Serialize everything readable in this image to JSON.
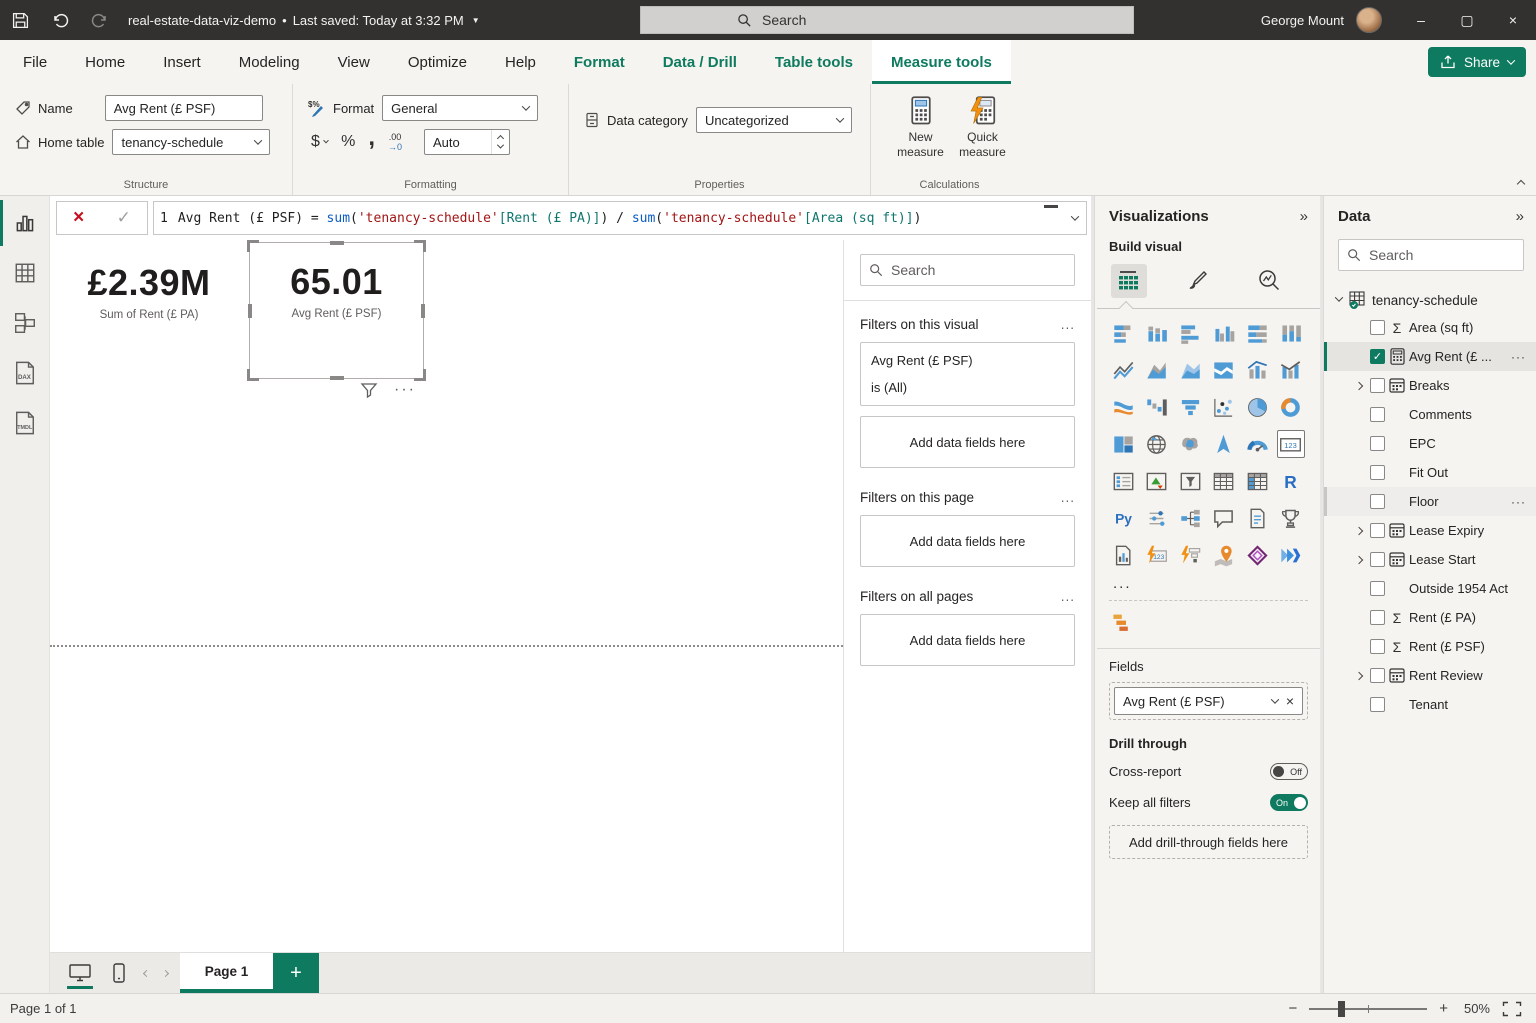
{
  "titlebar": {
    "title": "real-estate-data-viz-demo",
    "separator": "•",
    "saved": "Last saved: Today at 3:32 PM",
    "search_placeholder": "Search",
    "user": "George Mount",
    "minimize": "–",
    "maximize": "▢",
    "close": "×"
  },
  "menubar": {
    "tabs": [
      {
        "label": "File"
      },
      {
        "label": "Home"
      },
      {
        "label": "Insert"
      },
      {
        "label": "Modeling"
      },
      {
        "label": "View"
      },
      {
        "label": "Optimize"
      },
      {
        "label": "Help"
      },
      {
        "label": "Format",
        "ctx": true
      },
      {
        "label": "Data / Drill",
        "ctx": true
      },
      {
        "label": "Table tools",
        "ctx": true
      },
      {
        "label": "Measure tools",
        "ctx": true,
        "active": true
      }
    ],
    "share_label": "Share"
  },
  "ribbon": {
    "structure": {
      "label": "Structure",
      "name_label": "Name",
      "name_value": "Avg Rent (£ PSF)",
      "home_table_label": "Home table",
      "home_table_value": "tenancy-schedule"
    },
    "formatting": {
      "label": "Formatting",
      "format_label": "Format",
      "format_value": "General",
      "dollar": "$",
      "percent": "%",
      "comma": ",",
      "decimal_top": ".00",
      "decimal_bottom": "→0",
      "auto": "Auto"
    },
    "properties": {
      "label": "Properties",
      "data_category_label": "Data category",
      "data_category_value": "Uncategorized"
    },
    "calculations": {
      "label": "Calculations",
      "new_measure": "New measure",
      "quick_measure": "Quick measure"
    }
  },
  "formula": {
    "line_number": "1",
    "tokens": [
      {
        "t": "Avg Rent (£ PSF) = ",
        "c": "p"
      },
      {
        "t": "sum",
        "c": "f"
      },
      {
        "t": "(",
        "c": "p"
      },
      {
        "t": "'tenancy-schedule'",
        "c": "s"
      },
      {
        "t": "[Rent (£ PA)]",
        "c": "c"
      },
      {
        "t": ") / ",
        "c": "p"
      },
      {
        "t": "sum",
        "c": "f"
      },
      {
        "t": "(",
        "c": "p"
      },
      {
        "t": "'tenancy-schedule'",
        "c": "s"
      },
      {
        "t": "[Area (sq ft)]",
        "c": "c"
      },
      {
        "t": ")",
        "c": "p"
      }
    ]
  },
  "canvas": {
    "cards": [
      {
        "value": "£2.39M",
        "label": "Sum of Rent (£ PA)",
        "selected": false
      },
      {
        "value": "65.01",
        "label": "Avg Rent (£ PSF)",
        "selected": true
      }
    ]
  },
  "filters": {
    "search_placeholder": "Search",
    "sections": [
      {
        "title": "Filters on this visual",
        "more": "...",
        "cards": [
          {
            "field": "Avg Rent (£ PSF)",
            "condition": "is (All)"
          }
        ],
        "placeholder": "Add data fields here"
      },
      {
        "title": "Filters on this page",
        "more": "...",
        "cards": [],
        "placeholder": "Add data fields here"
      },
      {
        "title": "Filters on all pages",
        "more": "...",
        "cards": [],
        "placeholder": "Add data fields here"
      }
    ]
  },
  "visualizations": {
    "title": "Visualizations",
    "collapse": "»",
    "build_visual_label": "Build visual",
    "gallery": [
      {
        "n": "stacked-bar-chart",
        "k": "sbar"
      },
      {
        "n": "stacked-column-chart",
        "k": "scol"
      },
      {
        "n": "clustered-bar-chart",
        "k": "cbar"
      },
      {
        "n": "clustered-column-chart",
        "k": "ccol"
      },
      {
        "n": "100-stacked-bar-chart",
        "k": "pbar"
      },
      {
        "n": "100-stacked-column-chart",
        "k": "pcol"
      },
      {
        "n": "line-chart",
        "k": "line"
      },
      {
        "n": "area-chart",
        "k": "area"
      },
      {
        "n": "stacked-area-chart",
        "k": "sarea"
      },
      {
        "n": "100-stacked-area-chart",
        "k": "parea"
      },
      {
        "n": "line-and-stacked-column-chart",
        "k": "combo"
      },
      {
        "n": "line-and-clustered-column-chart",
        "k": "combo2"
      },
      {
        "n": "ribbon-chart",
        "k": "ribbon"
      },
      {
        "n": "waterfall-chart",
        "k": "waterfall"
      },
      {
        "n": "funnel-chart",
        "k": "funnel"
      },
      {
        "n": "scatter-chart",
        "k": "scatter"
      },
      {
        "n": "pie-chart",
        "k": "pie"
      },
      {
        "n": "donut-chart",
        "k": "donut"
      },
      {
        "n": "treemap",
        "k": "treemap"
      },
      {
        "n": "map",
        "k": "globe"
      },
      {
        "n": "filled-map",
        "k": "shapemap"
      },
      {
        "n": "azure-map",
        "k": "plane"
      },
      {
        "n": "gauge",
        "k": "gauge"
      },
      {
        "n": "card",
        "k": "card123",
        "selected": true
      },
      {
        "n": "multi-row-card",
        "k": "mcard"
      },
      {
        "n": "kpi",
        "k": "kpi"
      },
      {
        "n": "slicer",
        "k": "slicer"
      },
      {
        "n": "table",
        "k": "table"
      },
      {
        "n": "matrix",
        "k": "matrix"
      },
      {
        "n": "r-script-visual",
        "k": "R"
      },
      {
        "n": "python-visual",
        "k": "Py"
      },
      {
        "n": "key-influencers",
        "k": "keyinf"
      },
      {
        "n": "decomposition-tree",
        "k": "decomp"
      },
      {
        "n": "smart-narrative",
        "k": "speech"
      },
      {
        "n": "paginated-report",
        "k": "doc"
      },
      {
        "n": "metrics",
        "k": "trophy"
      },
      {
        "n": "report",
        "k": "docchart"
      },
      {
        "n": "scorecard",
        "k": "zapcard"
      },
      {
        "n": "automated-insights",
        "k": "zapfunnel"
      },
      {
        "n": "arcgis-map",
        "k": "pin"
      },
      {
        "n": "power-apps",
        "k": "papps"
      },
      {
        "n": "power-automate",
        "k": "pauto"
      }
    ],
    "more": "...",
    "custom_visual": "custom-visual-gantt",
    "fields_label": "Fields",
    "field_chip": "Avg Rent (£ PSF)",
    "drill_through": {
      "title": "Drill through",
      "cross_report_label": "Cross-report",
      "cross_report_state": "Off",
      "keep_filters_label": "Keep all filters",
      "keep_filters_state": "On",
      "placeholder": "Add drill-through fields here"
    }
  },
  "data_pane": {
    "title": "Data",
    "collapse": "»",
    "search_placeholder": "Search",
    "table_name": "tenancy-schedule",
    "fields": [
      {
        "label": "Area (sq ft)",
        "icon": "sigma"
      },
      {
        "label": "Avg Rent (£ ...",
        "icon": "calc",
        "checked": true,
        "selected": true,
        "more": "···"
      },
      {
        "label": "Breaks",
        "icon": "cal",
        "expand": true
      },
      {
        "label": "Comments"
      },
      {
        "label": "EPC"
      },
      {
        "label": "Fit Out"
      },
      {
        "label": "Floor",
        "hover": true,
        "more": "···"
      },
      {
        "label": "Lease Expiry",
        "icon": "cal",
        "expand": true
      },
      {
        "label": "Lease Start",
        "icon": "cal",
        "expand": true
      },
      {
        "label": "Outside 1954 Act"
      },
      {
        "label": "Rent (£ PA)",
        "icon": "sigma"
      },
      {
        "label": "Rent (£ PSF)",
        "icon": "sigma"
      },
      {
        "label": "Rent Review",
        "icon": "cal",
        "expand": true
      },
      {
        "label": "Tenant"
      }
    ]
  },
  "pagebar": {
    "page_tab": "Page 1",
    "add_page": "+"
  },
  "statusbar": {
    "left": "Page 1 of 1",
    "zoom_level": "50%"
  },
  "colors": {
    "accent_green": "#0e7a5f",
    "titlebar": "#323130",
    "ribbon_bg": "#f6f4f0",
    "dax_function": "#0b5cc4",
    "dax_string": "#a31515",
    "dax_column": "#0f766e",
    "cancel_red": "#c50f1f"
  }
}
